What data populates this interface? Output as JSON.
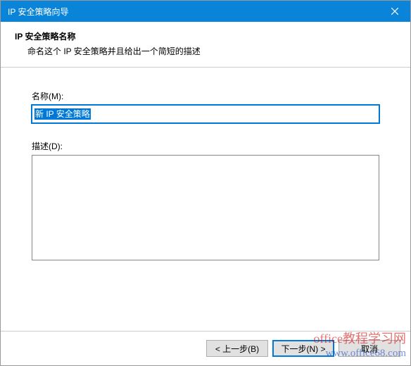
{
  "window": {
    "title": "IP 安全策略向导"
  },
  "header": {
    "title": "IP 安全策略名称",
    "subtitle": "命名这个 IP 安全策略并且给出一个简短的描述"
  },
  "fields": {
    "name_label": "名称(M):",
    "name_value": "新 IP 安全策略",
    "desc_label": "描述(D):",
    "desc_value": ""
  },
  "buttons": {
    "back": "< 上一步(B)",
    "next": "下一步(N) >",
    "cancel": "取消"
  },
  "watermark": {
    "line1": "office教程学习网",
    "line2": "www.office68.com"
  }
}
